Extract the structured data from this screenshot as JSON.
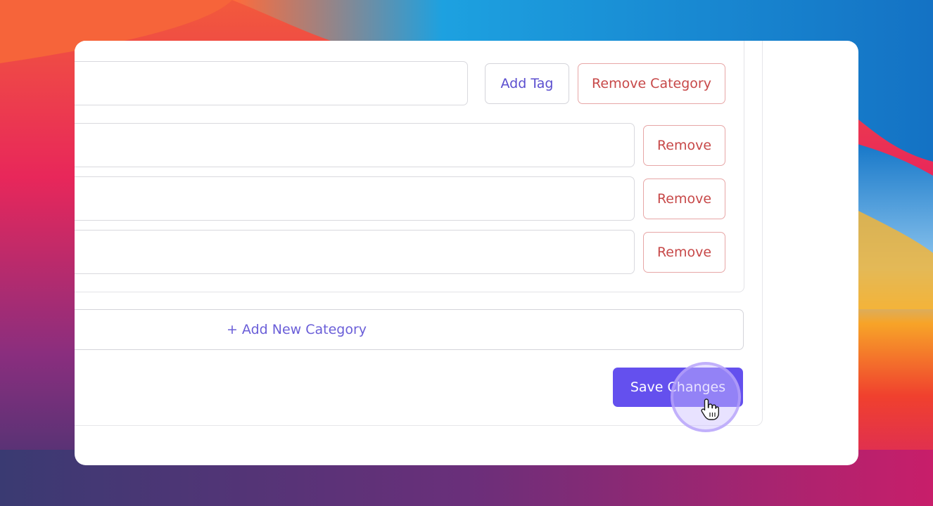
{
  "category_editor": {
    "add_tag_label": "Add Tag",
    "remove_category_label": "Remove Category",
    "tags": [
      {
        "value": "",
        "remove_label": "Remove"
      },
      {
        "value": "",
        "remove_label": "Remove"
      },
      {
        "value": "",
        "remove_label": "Remove"
      }
    ]
  },
  "add_category_label": "+ Add New Category",
  "save_label": "Save Changes",
  "colors": {
    "accent": "#6450ee",
    "danger": "#c74848",
    "link": "#6a5ed8"
  },
  "icons": {
    "cursor": "hand-pointer-icon"
  }
}
